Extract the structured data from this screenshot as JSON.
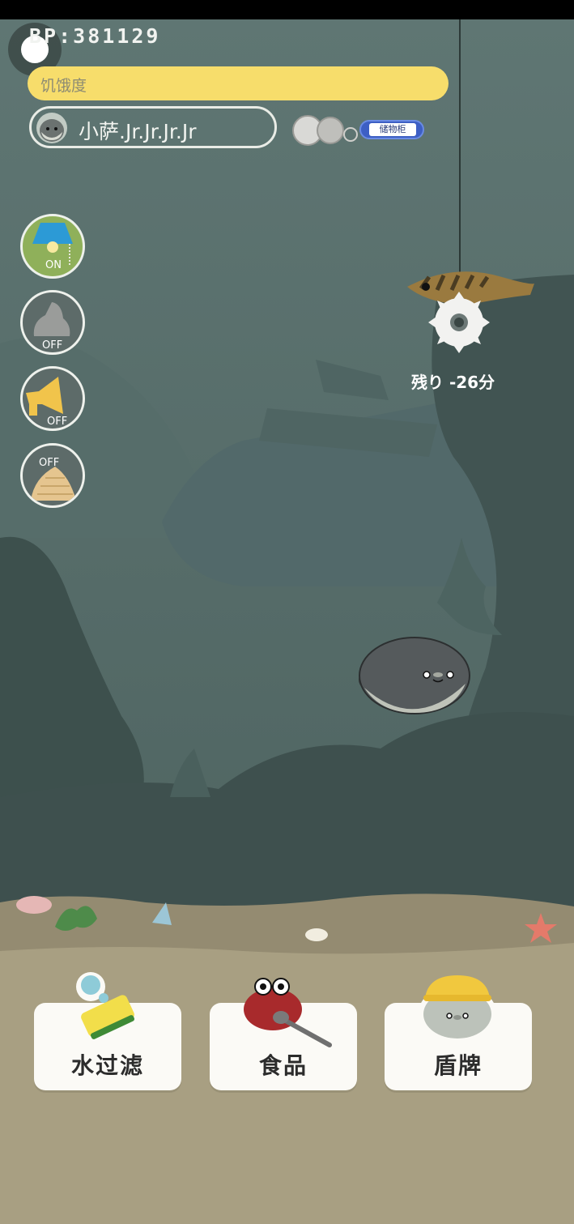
{
  "hud": {
    "bp_label": "BP:",
    "bp_value": "381129",
    "hunger_label": "饥饿度",
    "pet_name": "小萨.Jr.Jr.Jr.Jr",
    "locker_label": "储物柜"
  },
  "side_buttons": [
    {
      "name": "lamp",
      "status": "ON",
      "icon": "lamp-icon"
    },
    {
      "name": "rock",
      "status": "OFF",
      "icon": "rock-icon"
    },
    {
      "name": "speaker",
      "status": "OFF",
      "icon": "megaphone-icon"
    },
    {
      "name": "shell",
      "status": "OFF",
      "icon": "shell-icon"
    }
  ],
  "bait": {
    "item": "shrimp",
    "timer_text": "残り -26分"
  },
  "menu": [
    {
      "label": "水过滤",
      "icon": "sponge-icon"
    },
    {
      "label": "食品",
      "icon": "crab-tongs-icon"
    },
    {
      "label": "盾牌",
      "icon": "seal-hat-icon"
    }
  ],
  "colors": {
    "hunger_bar": "#f7dd6b",
    "water": "#5b7370",
    "sand": "#a89f82",
    "locker_tag": "#3d5fc4"
  }
}
